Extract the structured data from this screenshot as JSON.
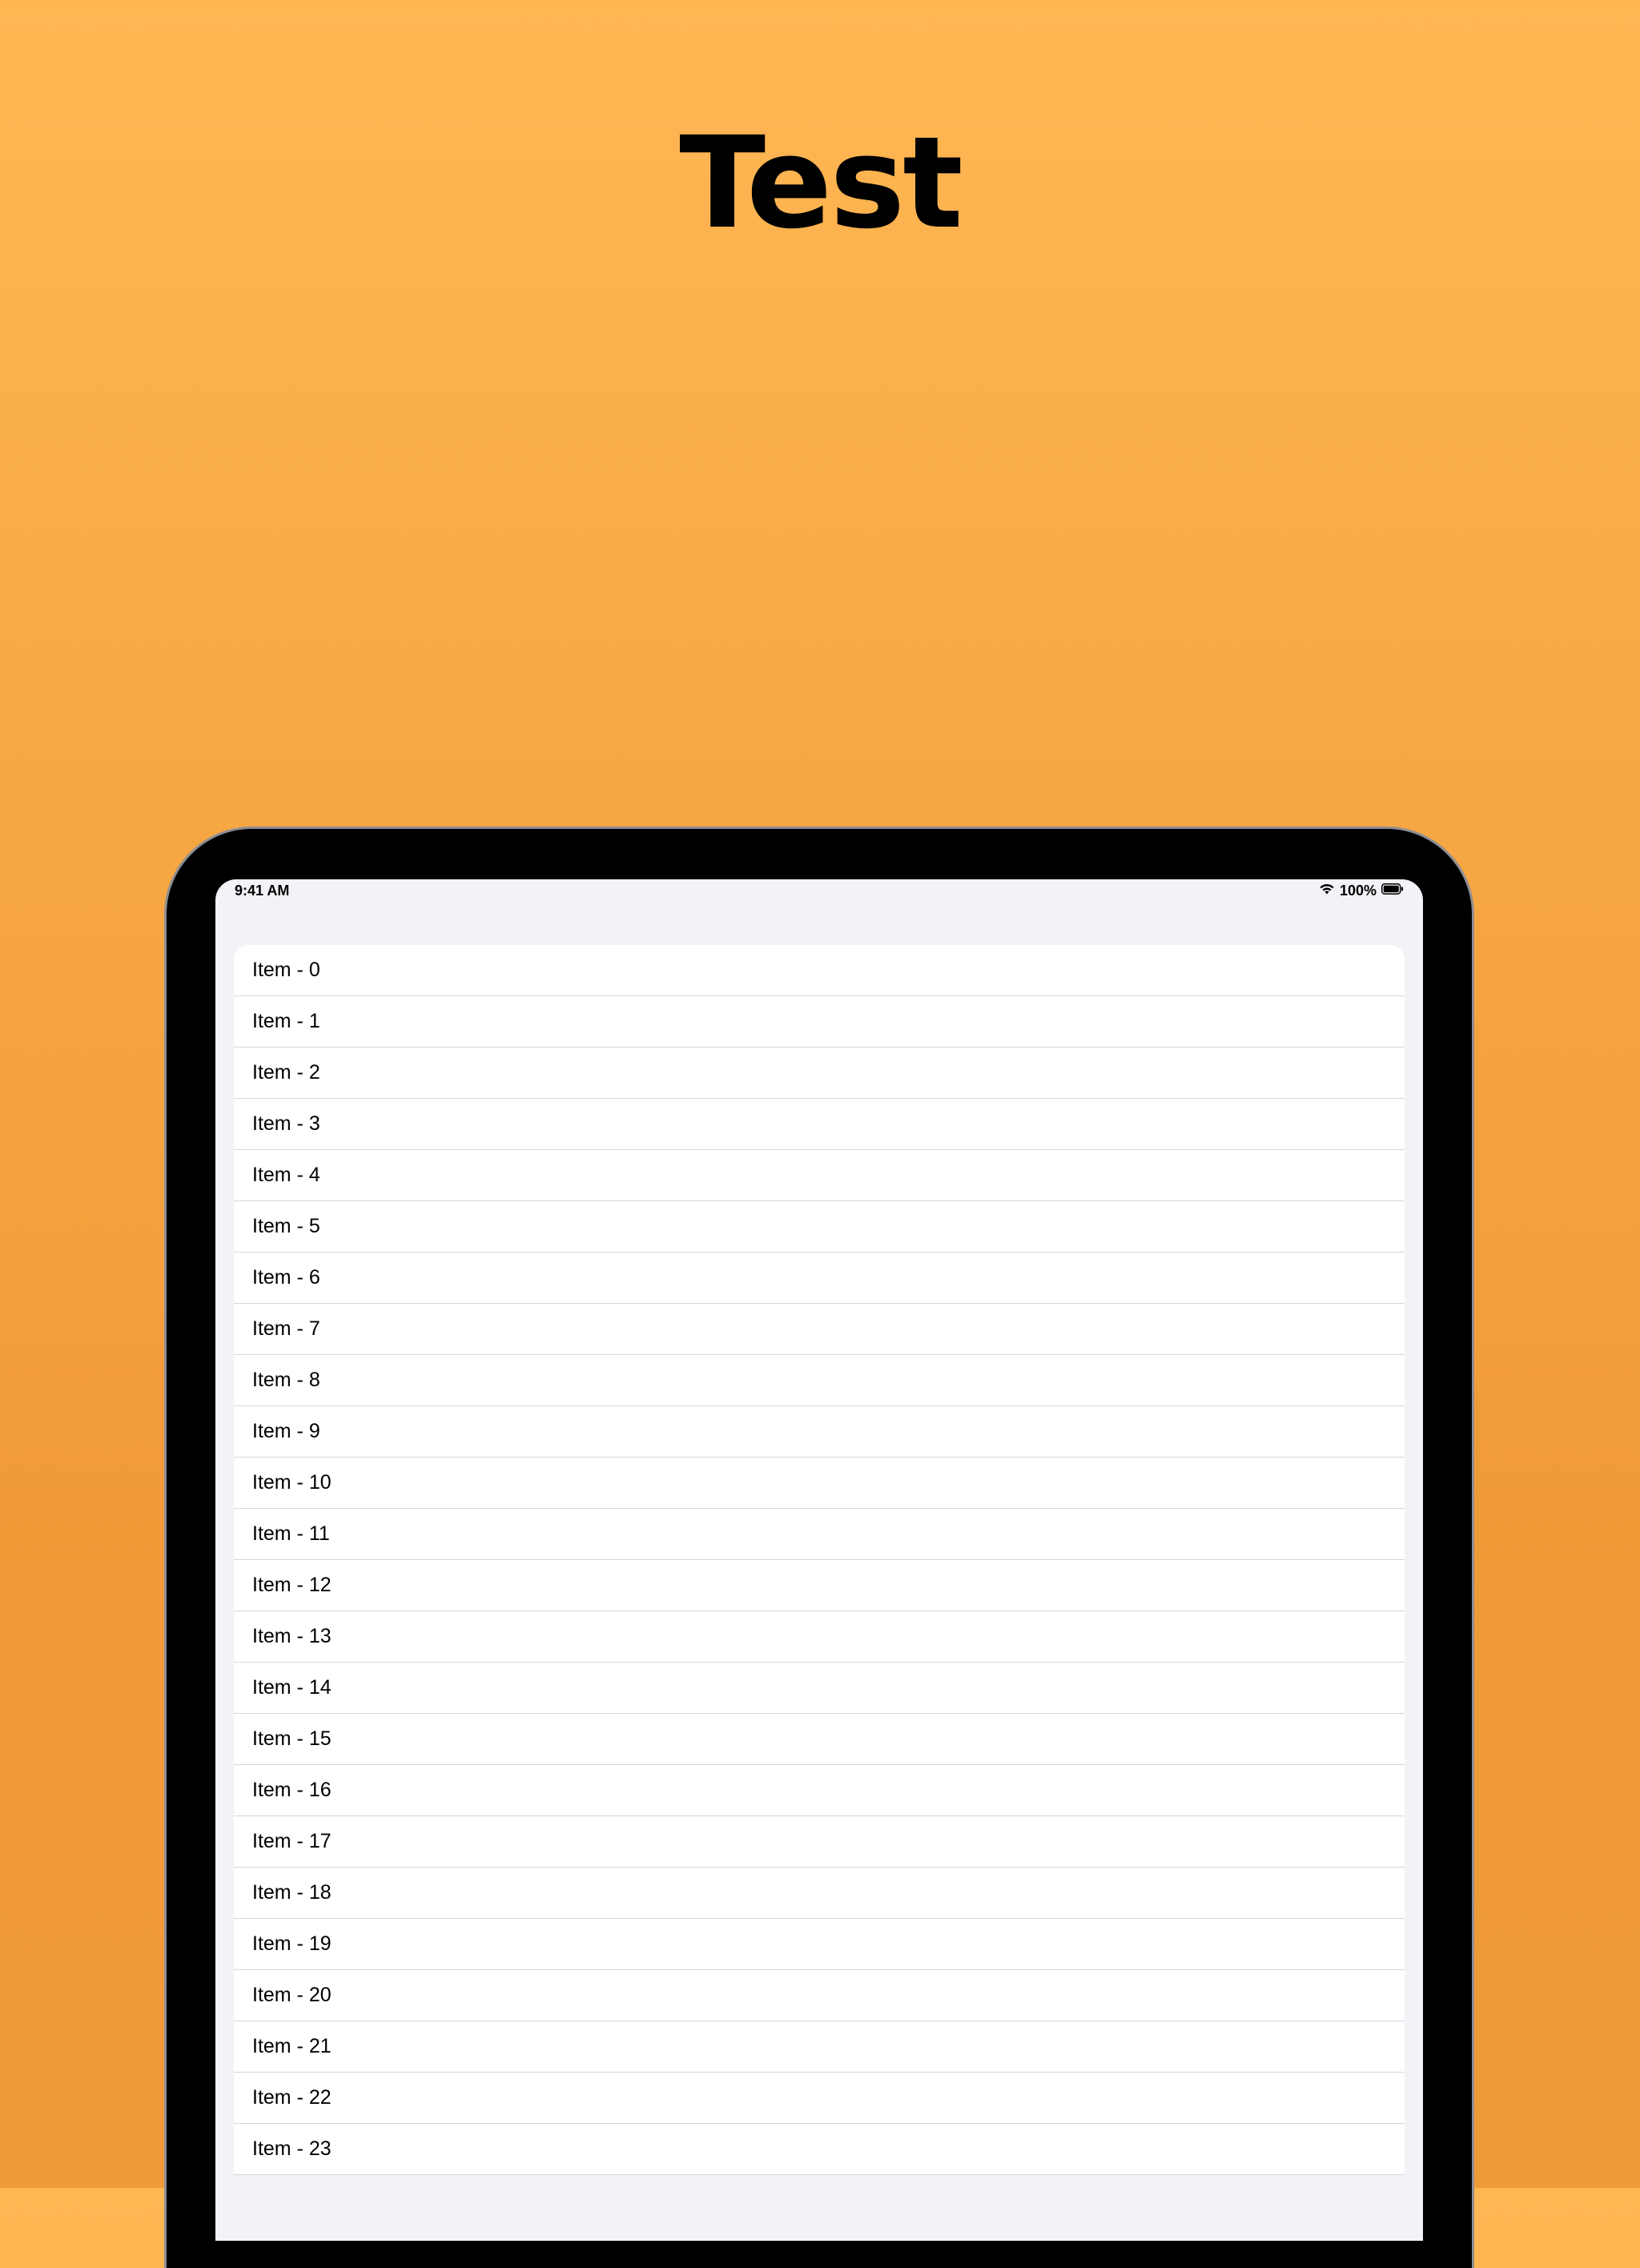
{
  "marketing": {
    "title": "Test"
  },
  "status_bar": {
    "time": "9:41 AM",
    "battery_percent": "100%",
    "icons": [
      "wifi-icon",
      "battery-icon"
    ]
  },
  "list": {
    "items": [
      {
        "label": "Item - 0"
      },
      {
        "label": "Item - 1"
      },
      {
        "label": "Item - 2"
      },
      {
        "label": "Item - 3"
      },
      {
        "label": "Item - 4"
      },
      {
        "label": "Item - 5"
      },
      {
        "label": "Item - 6"
      },
      {
        "label": "Item - 7"
      },
      {
        "label": "Item - 8"
      },
      {
        "label": "Item - 9"
      },
      {
        "label": "Item - 10"
      },
      {
        "label": "Item - 11"
      },
      {
        "label": "Item - 12"
      },
      {
        "label": "Item - 13"
      },
      {
        "label": "Item - 14"
      },
      {
        "label": "Item - 15"
      },
      {
        "label": "Item - 16"
      },
      {
        "label": "Item - 17"
      },
      {
        "label": "Item - 18"
      },
      {
        "label": "Item - 19"
      },
      {
        "label": "Item - 20"
      },
      {
        "label": "Item - 21"
      },
      {
        "label": "Item - 22"
      },
      {
        "label": "Item - 23"
      }
    ]
  },
  "colors": {
    "background_top": "#ffb754",
    "background_bottom": "#ef9a39",
    "screen_background": "#f2f2f7",
    "row_background": "#ffffff",
    "separator": "#d6d6da",
    "device_frame": "#000000"
  }
}
